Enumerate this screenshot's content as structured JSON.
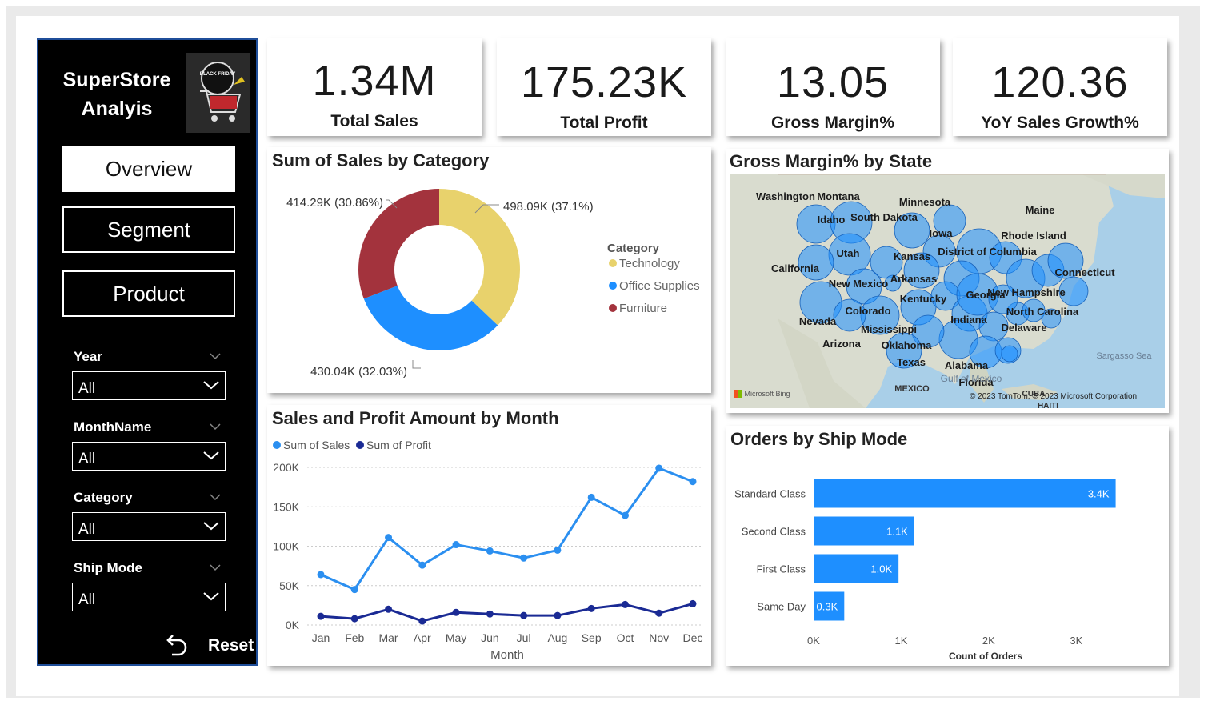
{
  "sidebar": {
    "title_line1": "SuperStore",
    "title_line2": "Analyis",
    "logo_text": "BLACK FRIDAY",
    "nav": [
      {
        "label": "Overview",
        "active": true
      },
      {
        "label": "Segment",
        "active": false
      },
      {
        "label": "Product",
        "active": false
      }
    ],
    "filters": [
      {
        "label": "Year",
        "value": "All"
      },
      {
        "label": "MonthName",
        "value": "All"
      },
      {
        "label": "Category",
        "value": "All"
      },
      {
        "label": "Ship Mode",
        "value": "All"
      }
    ],
    "reset_label": "Reset",
    "reset_icon": "undo-arrow-icon"
  },
  "kpis": [
    {
      "value": "1.34M",
      "label": "Total Sales"
    },
    {
      "value": "175.23K",
      "label": "Total Profit"
    },
    {
      "value": "13.05",
      "label": "Gross Margin%"
    },
    {
      "value": "120.36",
      "label": "YoY Sales Growth%"
    }
  ],
  "map": {
    "title": "Gross Margin% by State",
    "states": [
      "Washington",
      "Montana",
      "Minnesota",
      "Idaho",
      "South Dakota",
      "Maine",
      "Iowa",
      "Rhode Island",
      "Utah",
      "Kansas",
      "District of Columbia",
      "California",
      "Connecticut",
      "New Mexico",
      "Arkansas",
      "Kentucky",
      "Georgia",
      "New Hampshire",
      "Colorado",
      "North Carolina",
      "Nevada",
      "Indiana",
      "Mississippi",
      "Delaware",
      "Arizona",
      "Oklahoma",
      "Texas",
      "Alabama",
      "Florida"
    ],
    "geo_labels": [
      "Sargasso Sea",
      "Gulf of Mexico",
      "MEXICO",
      "CUBA",
      "HAITI"
    ],
    "logo_text": "Microsoft Bing",
    "attribution": "© 2023 TomTom, © 2023 Microsoft Corporation",
    "bubble_color": "#1e90ff"
  },
  "chart_data": [
    {
      "type": "pie",
      "variant": "donut",
      "title": "Sum of Sales by Category",
      "legend_title": "Category",
      "legend_position": "right",
      "slices": [
        {
          "name": "Technology",
          "value": 498.09,
          "label": "498.09K (37.1%)",
          "color": "#e8d26c"
        },
        {
          "name": "Office Supplies",
          "value": 430.04,
          "label": "430.04K (32.03%)",
          "color": "#1e8fff"
        },
        {
          "name": "Furniture",
          "value": 414.29,
          "label": "414.29K (30.86%)",
          "color": "#a3333d"
        }
      ]
    },
    {
      "type": "line",
      "title": "Sales and Profit Amount by Month",
      "xlabel": "Month",
      "ylabel": "",
      "legend_position": "top-left",
      "categories": [
        "Jan",
        "Feb",
        "Mar",
        "Apr",
        "May",
        "Jun",
        "Jul",
        "Aug",
        "Sep",
        "Oct",
        "Nov",
        "Dec"
      ],
      "ylim": [
        0,
        200000
      ],
      "yticks": [
        "0K",
        "50K",
        "100K",
        "150K",
        "200K"
      ],
      "grid": true,
      "series": [
        {
          "name": "Sum of Sales",
          "color": "#2b8ff0",
          "values": [
            64000,
            45000,
            111000,
            76000,
            102000,
            94000,
            85000,
            95000,
            162000,
            139000,
            199000,
            182000
          ]
        },
        {
          "name": "Sum of Profit",
          "color": "#1a2a94",
          "values": [
            11000,
            8000,
            20000,
            5000,
            16000,
            14000,
            12000,
            12000,
            21000,
            26000,
            15000,
            27000
          ]
        }
      ]
    },
    {
      "type": "bar",
      "orientation": "horizontal",
      "title": "Orders by Ship Mode",
      "xlabel": "Count of Orders",
      "ylabel": "",
      "categories": [
        "Standard Class",
        "Second Class",
        "First Class",
        "Same Day"
      ],
      "values": [
        3450,
        1150,
        970,
        350
      ],
      "data_labels": [
        "3.4K",
        "1.1K",
        "1.0K",
        "0.3K"
      ],
      "xticks": [
        "0K",
        "1K",
        "2K",
        "3K"
      ],
      "xlim": [
        0,
        3600
      ],
      "color": "#1e8fff"
    }
  ]
}
